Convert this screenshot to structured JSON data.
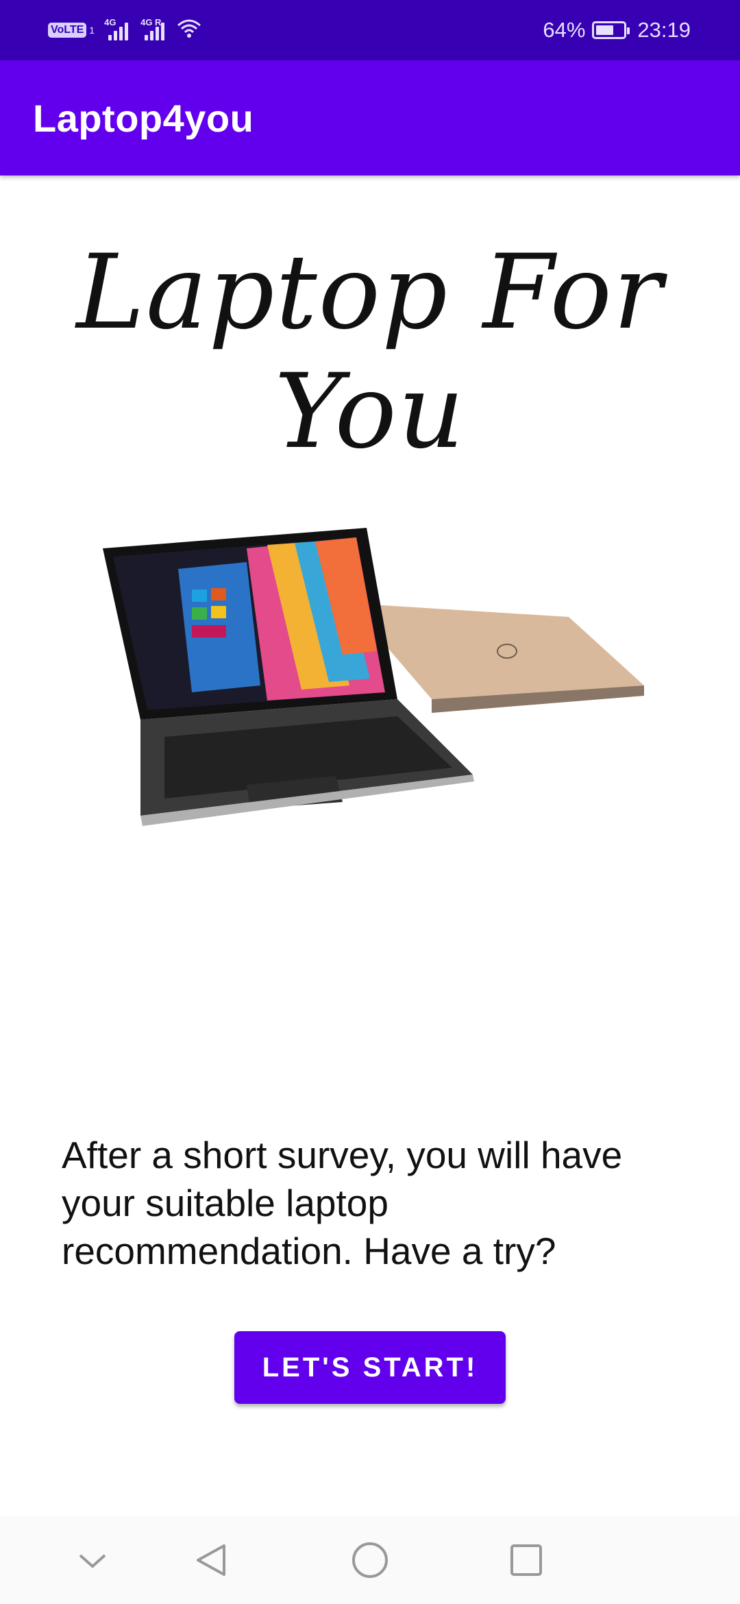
{
  "status_bar": {
    "volte": "VoLTE",
    "sim": "1",
    "network1": "4G",
    "network2": "4G R",
    "battery_percent": "64%",
    "battery_level": 0.64,
    "time": "23:19"
  },
  "app_bar": {
    "title": "Laptop4you"
  },
  "main": {
    "hero_title": "Laptop For You",
    "description": "After a short survey, you will have your suitable laptop recommendation. Have a try?",
    "start_button": "LET'S START!"
  },
  "nav_bar": {
    "buttons": [
      "chevron-down-icon",
      "back-icon",
      "home-icon",
      "recents-icon"
    ]
  },
  "colors": {
    "status_bar": "#3700b3",
    "primary": "#6200ee",
    "text": "#111111"
  }
}
